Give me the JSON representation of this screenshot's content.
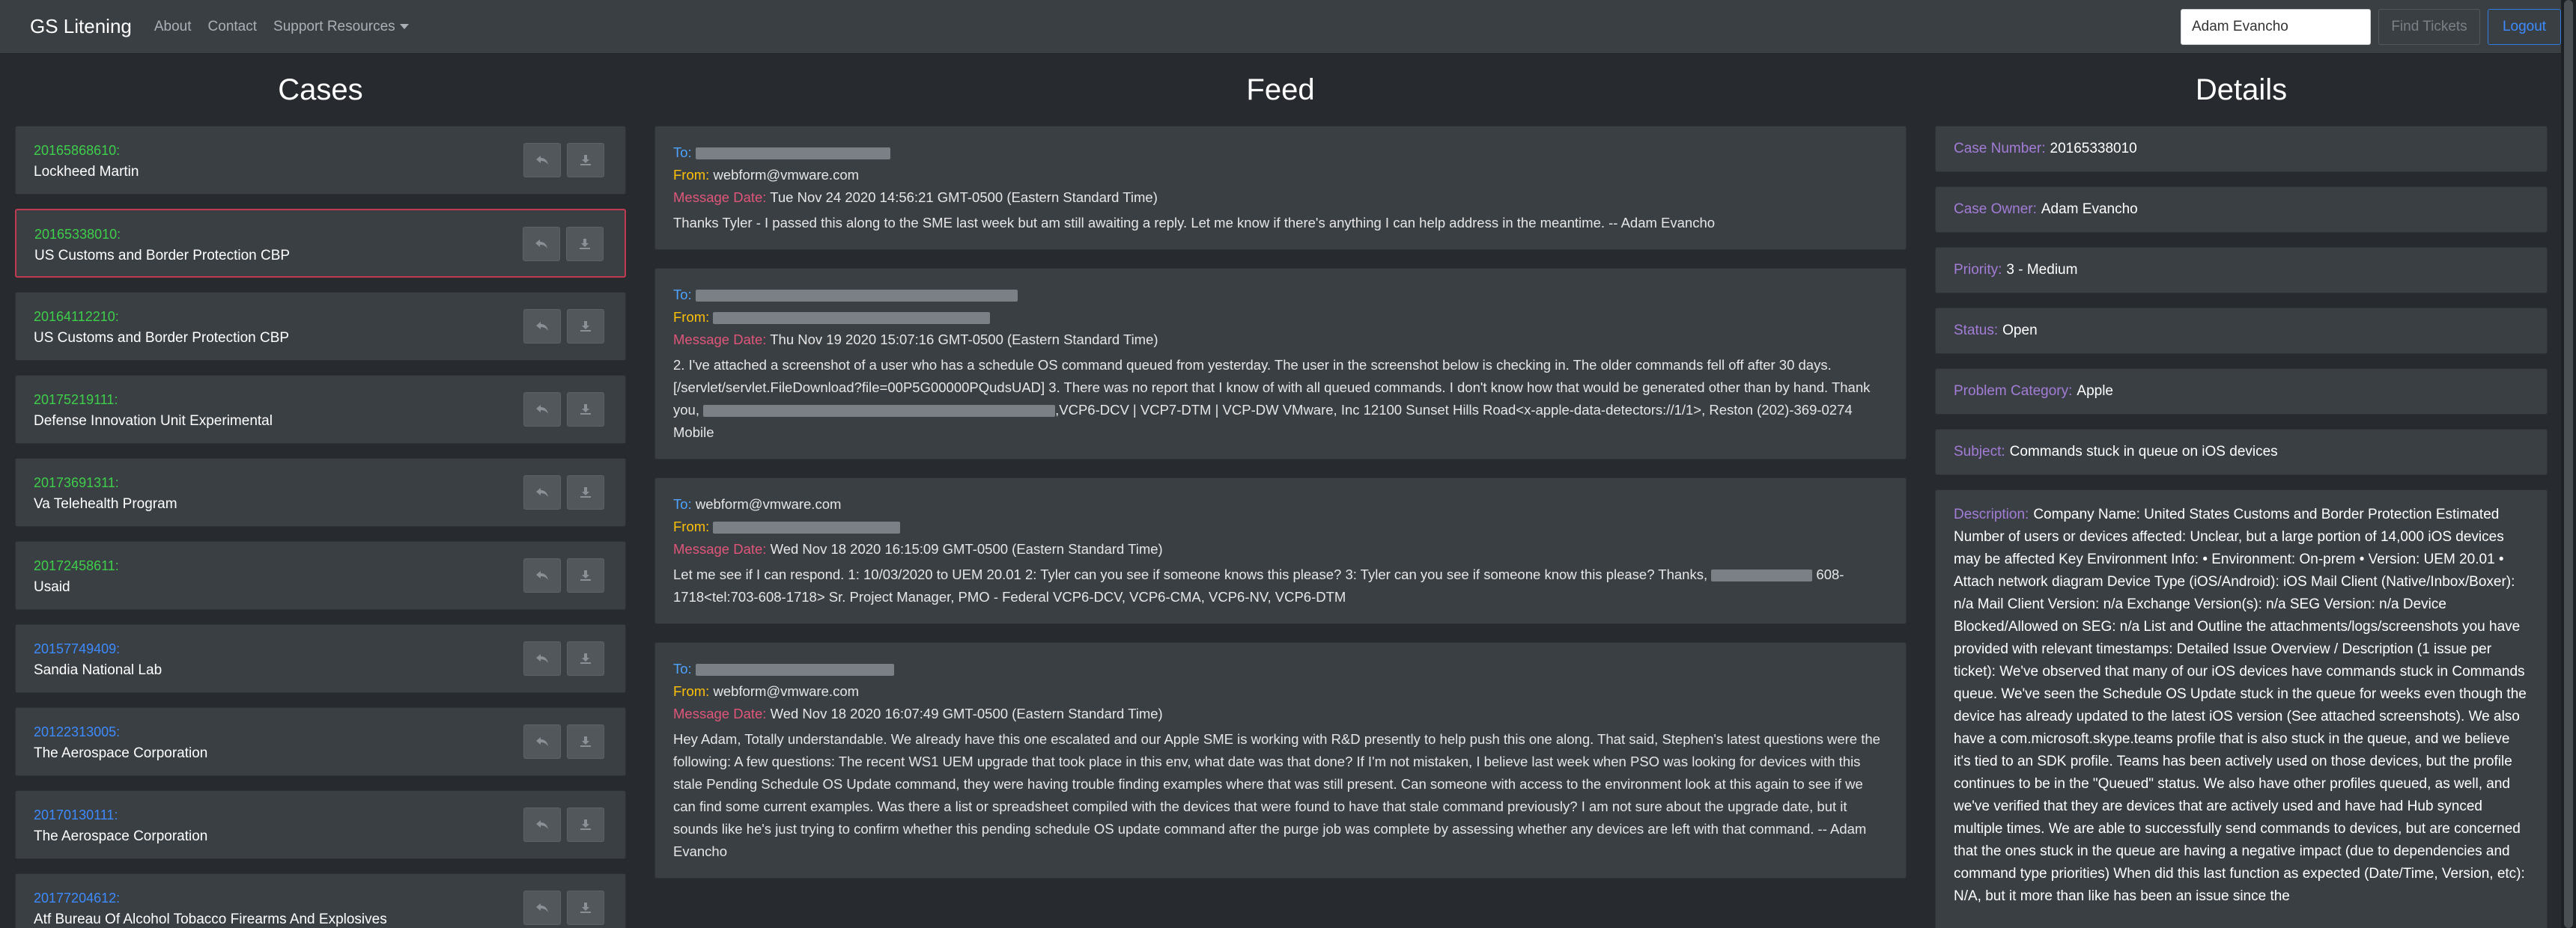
{
  "navbar": {
    "brand": "GS Litening",
    "links": [
      "About",
      "Contact",
      "Support Resources"
    ],
    "search_value": "Adam Evancho",
    "find_label": "Find Tickets",
    "logout_label": "Logout"
  },
  "headings": {
    "cases": "Cases",
    "feed": "Feed",
    "details": "Details"
  },
  "colors": {
    "case_number_green": "#3ecf4a",
    "case_number_blue": "#3d8bfd",
    "active_border": "#c03a52"
  },
  "cases": [
    {
      "number": "20165868610:",
      "name": "Lockheed Martin",
      "color": "green",
      "active": false
    },
    {
      "number": "20165338010:",
      "name": "US Customs and Border Protection CBP",
      "color": "green",
      "active": true
    },
    {
      "number": "20164112210:",
      "name": "US Customs and Border Protection CBP",
      "color": "green",
      "active": false
    },
    {
      "number": "20175219111:",
      "name": "Defense Innovation Unit Experimental",
      "color": "green",
      "active": false
    },
    {
      "number": "20173691311:",
      "name": "Va Telehealth Program",
      "color": "green",
      "active": false
    },
    {
      "number": "20172458611:",
      "name": "Usaid",
      "color": "green",
      "active": false
    },
    {
      "number": "20157749409:",
      "name": "Sandia National Lab",
      "color": "blue",
      "active": false
    },
    {
      "number": "20122313005:",
      "name": "The Aerospace Corporation",
      "color": "blue",
      "active": false
    },
    {
      "number": "20170130111:",
      "name": "The Aerospace Corporation",
      "color": "blue",
      "active": false
    },
    {
      "number": "20177204612:",
      "name": "Atf Bureau Of Alcohol Tobacco Firearms And Explosives",
      "color": "blue",
      "active": false
    }
  ],
  "feed": {
    "labels": {
      "to": "To:",
      "from": "From:",
      "date": "Message Date:"
    },
    "messages": [
      {
        "to": "",
        "from": "webform@vmware.com",
        "date": "Tue Nov 24 2020 14:56:21 GMT-0500 (Eastern Standard Time)",
        "body": "Thanks Tyler - I passed this along to the SME last week but am still awaiting a reply. Let me know if there's anything I can help address in the meantime. -- Adam Evancho"
      },
      {
        "to": "",
        "from": "",
        "date": "Thu Nov 19 2020 15:07:16 GMT-0500 (Eastern Standard Time)",
        "body_a": "2. I've attached a screenshot of a user who has a schedule OS command queued from yesterday. The user in the screenshot below is checking in. The older commands fell off after 30 days. [/servlet/servlet.FileDownload?file=00P5G00000PQudsUAD] 3. There was no report that I know of with all queued commands. I don't know how that would be generated other than by hand. Thank you,",
        "body_b": ",VCP6-DCV | VCP7-DTM | VCP-DW VMware, Inc 12100 Sunset Hills Road<x-apple-data-detectors://1/1>, Reston (202)-369-0274 Mobile"
      },
      {
        "to": "webform@vmware.com",
        "from": "",
        "date": "Wed Nov 18 2020 16:15:09 GMT-0500 (Eastern Standard Time)",
        "body_a": "Let me see if I can respond. 1: 10/03/2020 to UEM 20.01 2: Tyler can you see if someone knows this please? 3: Tyler can you see if someone know this please? Thanks,",
        "body_b": "608-1718<tel:703-608-1718> Sr. Project Manager, PMO - Federal VCP6-DCV, VCP6-CMA, VCP6-NV, VCP6-DTM"
      },
      {
        "to": "",
        "from": "webform@vmware.com",
        "date": "Wed Nov 18 2020 16:07:49 GMT-0500 (Eastern Standard Time)",
        "body": "Hey Adam, Totally understandable. We already have this one escalated and our Apple SME is working with R&D presently to help push this one along. That said, Stephen's latest questions were the following: A few questions: The recent WS1 UEM upgrade that took place in this env, what date was that done? If I'm not mistaken, I believe last week when PSO was looking for devices with this stale Pending Schedule OS Update command, they were having trouble finding examples where that was still present. Can someone with access to the environment look at this again to see if we can find some current examples. Was there a list or spreadsheet compiled with the devices that were found to have that stale command previously? I am not sure about the upgrade date, but it sounds like he's just trying to confirm whether this pending schedule OS update command after the purge job was complete by assessing whether any devices are left with that command. -- Adam Evancho"
      }
    ]
  },
  "details": {
    "case_number_label": "Case Number:",
    "case_number": "20165338010",
    "case_owner_label": "Case Owner:",
    "case_owner": "Adam Evancho",
    "priority_label": "Priority:",
    "priority": "3 - Medium",
    "status_label": "Status:",
    "status": "Open",
    "problem_category_label": "Problem Category:",
    "problem_category": "Apple",
    "subject_label": "Subject:",
    "subject": "Commands stuck in queue on iOS devices",
    "description_label": "Description:",
    "description": "Company Name: United States Customs and Border Protection Estimated Number of users or devices affected: Unclear, but a large portion of 14,000 iOS devices may be affected Key Environment Info: • Environment: On-prem • Version: UEM 20.01 • Attach network diagram   Device Type (iOS/Android): iOS Mail Client (Native/Inbox/Boxer): n/a Mail Client Version: n/a Exchange Version(s): n/a SEG Version: n/a Device Blocked/Allowed on SEG: n/a    List and Outline the attachments/logs/screenshots you have provided with relevant timestamps: Detailed Issue Overview / Description (1 issue per ticket): We've observed that many of our iOS devices have commands stuck in Commands queue. We've seen the Schedule OS Update stuck in the queue for weeks even though the device has already updated to the latest iOS version (See attached screenshots). We also have a com.microsoft.skype.teams profile that is also stuck in the queue, and we believe it's tied to an SDK profile. Teams has been actively used on those devices, but the profile continues to be in the \"Queued\" status. We also have other profiles queued, as well, and we've verified that they are devices that are actively used and have had Hub synced multiple times. We are able to successfully send commands to devices, but are concerned that the ones stuck in the queue are having a negative impact (due to dependencies and command type priorities) When did this last function as expected (Date/Time, Version, etc): N/A, but it more than like has been an issue since the"
  }
}
